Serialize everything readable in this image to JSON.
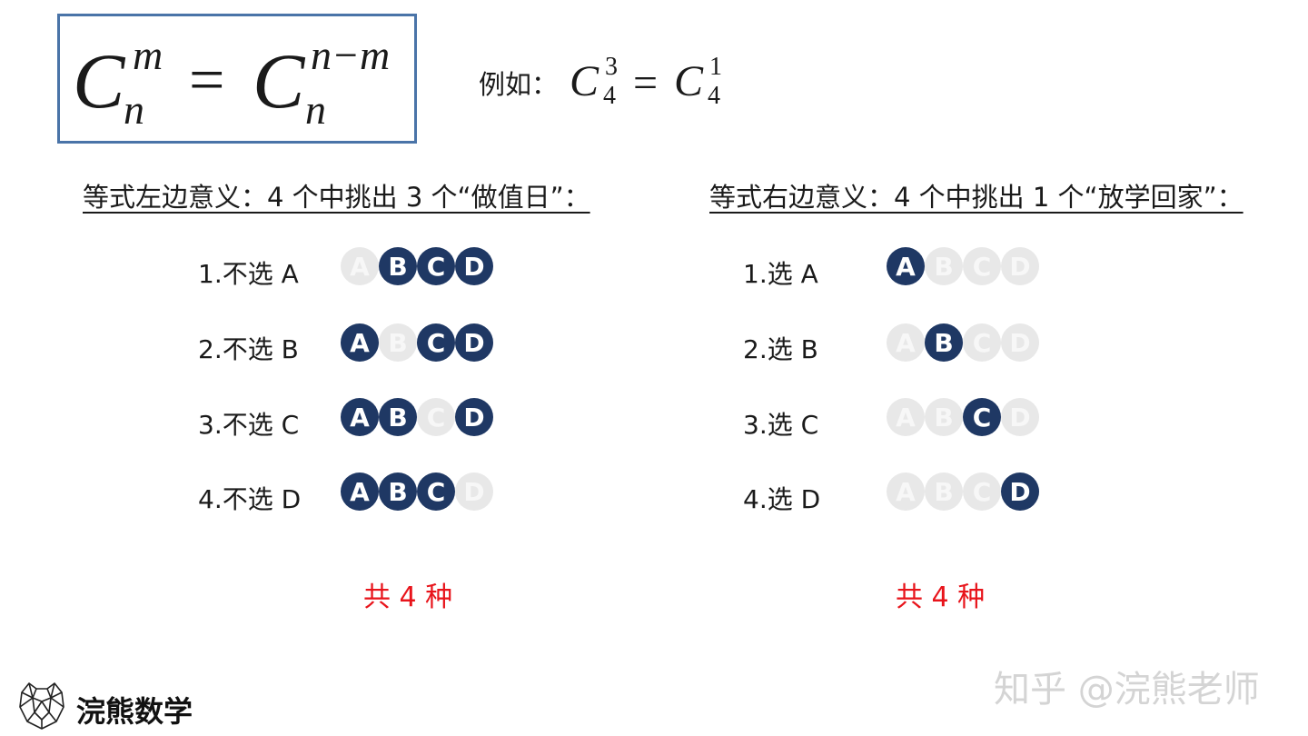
{
  "formula": {
    "lhs_letter": "C",
    "lhs_sup": "m",
    "lhs_sub": "n",
    "equals": "=",
    "rhs_letter": "C",
    "rhs_sup": "n−m",
    "rhs_sub": "n"
  },
  "example": {
    "label": "例如：",
    "lhs_letter": "C",
    "lhs_sup": "3",
    "lhs_sub": "4",
    "equals": "=",
    "rhs_letter": "C",
    "rhs_sup": "1",
    "rhs_sub": "4"
  },
  "left": {
    "heading": "等式左边意义：4 个中挑出 3 个“做值日”：",
    "rows": [
      {
        "label": "1.不选 A",
        "selected": [
          false,
          true,
          true,
          true
        ]
      },
      {
        "label": "2.不选 B",
        "selected": [
          true,
          false,
          true,
          true
        ]
      },
      {
        "label": "3.不选 C",
        "selected": [
          true,
          true,
          false,
          true
        ]
      },
      {
        "label": "4.不选 D",
        "selected": [
          true,
          true,
          true,
          false
        ]
      }
    ],
    "total": "共 4 种"
  },
  "right": {
    "heading": "等式右边意义：4 个中挑出 1 个“放学回家”：",
    "rows": [
      {
        "label": "1.选 A",
        "selected": [
          true,
          false,
          false,
          false
        ]
      },
      {
        "label": "2.选 B",
        "selected": [
          false,
          true,
          false,
          false
        ]
      },
      {
        "label": "3.选 C",
        "selected": [
          false,
          false,
          true,
          false
        ]
      },
      {
        "label": "4.选 D",
        "selected": [
          false,
          false,
          false,
          true
        ]
      }
    ],
    "total": "共 4 种"
  },
  "circle_letters": [
    "A",
    "B",
    "C",
    "D"
  ],
  "colors": {
    "selected": "#1f3864",
    "unselected": "#e8e8e8",
    "total_text": "#e8141b",
    "box_border": "#4a74a8"
  },
  "brand": {
    "logo_icon": "bear-head-icon",
    "name": "浣熊数学"
  },
  "watermark": "知乎 @浣熊老师"
}
